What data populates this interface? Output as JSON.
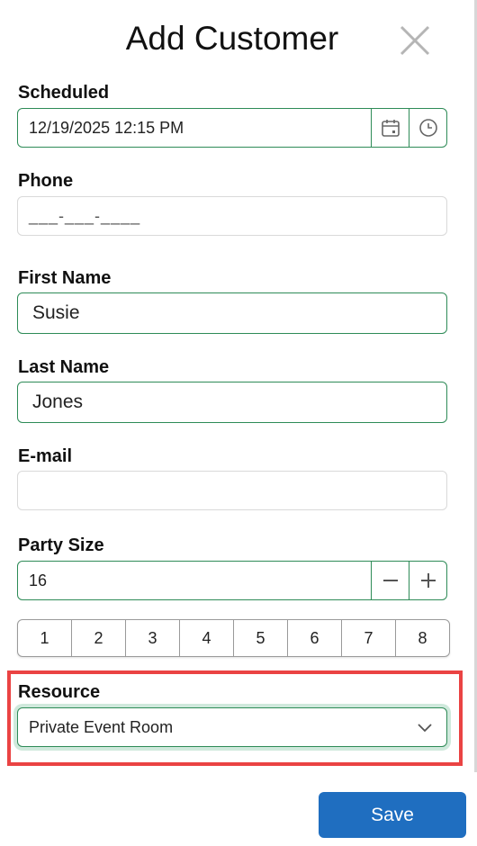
{
  "dialog": {
    "title": "Add Customer",
    "close_icon": "close-icon"
  },
  "scheduled": {
    "label": "Scheduled",
    "value": "12/19/2025 12:15 PM",
    "calendar_icon": "calendar-icon",
    "clock_icon": "clock-icon"
  },
  "phone": {
    "label": "Phone",
    "value": "___-___-____"
  },
  "first_name": {
    "label": "First Name",
    "value": "Susie"
  },
  "last_name": {
    "label": "Last Name",
    "value": "Jones"
  },
  "email": {
    "label": "E-mail",
    "value": ""
  },
  "party_size": {
    "label": "Party Size",
    "value": "16",
    "decrement_icon": "minus-icon",
    "increment_icon": "plus-icon",
    "quick_picks": [
      "1",
      "2",
      "3",
      "4",
      "5",
      "6",
      "7",
      "8"
    ]
  },
  "resource": {
    "label": "Resource",
    "selected": "Private Event Room",
    "dropdown_icon": "chevron-down-icon"
  },
  "actions": {
    "save_label": "Save"
  },
  "colors": {
    "accent_green": "#2e8b57",
    "save_blue": "#1f6ec0",
    "highlight_red": "#ea4343"
  }
}
